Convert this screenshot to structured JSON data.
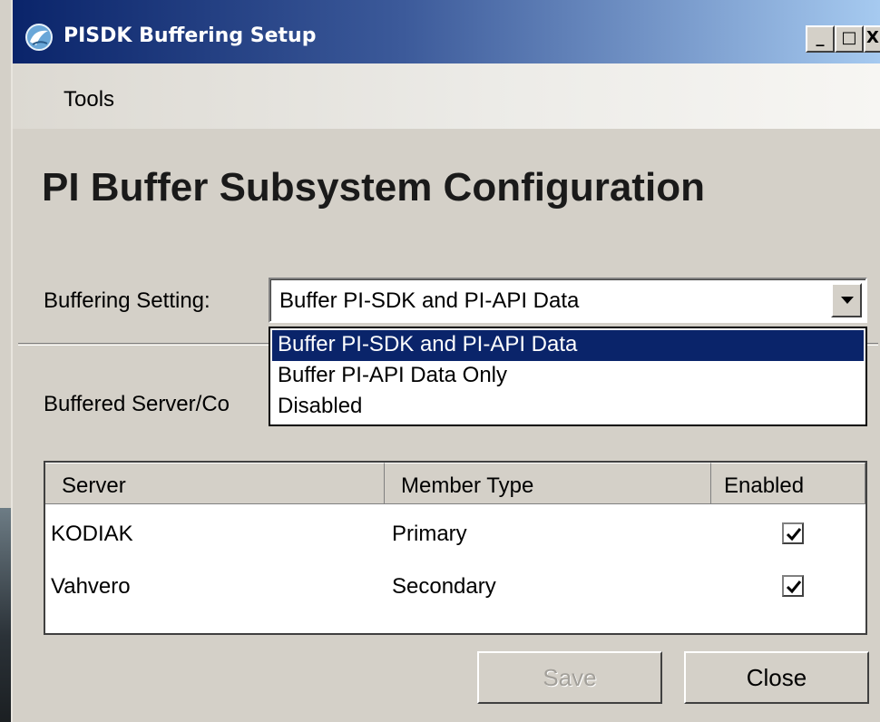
{
  "window": {
    "title": "PISDK Buffering Setup",
    "controls": {
      "minimize": "_",
      "maximize": "□",
      "close": "X"
    }
  },
  "menu": {
    "items": [
      {
        "label": "Tools"
      }
    ]
  },
  "heading": "PI Buffer Subsystem Configuration",
  "buffering": {
    "label": "Buffering Setting:",
    "selected_value": "Buffer PI-SDK and PI-API Data",
    "options": [
      "Buffer PI-SDK and PI-API Data",
      "Buffer PI-API Data Only",
      "Disabled"
    ],
    "dropdown_open": true
  },
  "servers": {
    "label": "Buffered Server/Co",
    "columns": [
      "Server",
      "Member Type",
      "Enabled"
    ],
    "rows": [
      {
        "server": "KODIAK",
        "member_type": "Primary",
        "enabled": true
      },
      {
        "server": "Vahvero",
        "member_type": "Secondary",
        "enabled": true
      }
    ]
  },
  "buttons": {
    "save": {
      "label": "Save",
      "enabled": false
    },
    "close": {
      "label": "Close",
      "enabled": true
    }
  },
  "colors": {
    "titlebar_start": "#0a246a",
    "titlebar_end": "#a6caf0",
    "selection": "#0a246a",
    "face": "#d4d0c8"
  },
  "icons": {
    "app": "pi-sdk-app-icon",
    "dropdown": "chevron-down-icon",
    "checkbox": "checkmark-icon"
  }
}
